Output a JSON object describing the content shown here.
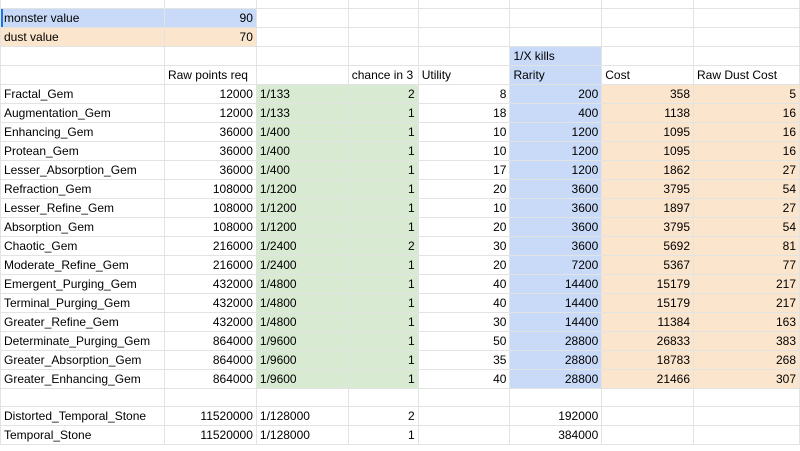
{
  "settings": [
    {
      "label": "monster value",
      "value": "90"
    },
    {
      "label": "dust value",
      "value": "70"
    }
  ],
  "header_top": {
    "rarity": "1/X kills"
  },
  "headers": {
    "raw_points": "Raw points req",
    "chance": "chance in 3",
    "utility": "Utility",
    "rarity": "Rarity",
    "cost": "Cost",
    "raw_dust": "Raw Dust Cost"
  },
  "rows": [
    {
      "name": "Fractal_Gem",
      "points": "12000",
      "frac": "1/133",
      "chance": "2",
      "utility": "8",
      "rarity": "200",
      "cost": "358",
      "dust": "5"
    },
    {
      "name": "Augmentation_Gem",
      "points": "12000",
      "frac": "1/133",
      "chance": "1",
      "utility": "18",
      "rarity": "400",
      "cost": "1138",
      "dust": "16"
    },
    {
      "name": "Enhancing_Gem",
      "points": "36000",
      "frac": "1/400",
      "chance": "1",
      "utility": "10",
      "rarity": "1200",
      "cost": "1095",
      "dust": "16"
    },
    {
      "name": "Protean_Gem",
      "points": "36000",
      "frac": "1/400",
      "chance": "1",
      "utility": "10",
      "rarity": "1200",
      "cost": "1095",
      "dust": "16"
    },
    {
      "name": "Lesser_Absorption_Gem",
      "points": "36000",
      "frac": "1/400",
      "chance": "1",
      "utility": "17",
      "rarity": "1200",
      "cost": "1862",
      "dust": "27"
    },
    {
      "name": "Refraction_Gem",
      "points": "108000",
      "frac": "1/1200",
      "chance": "1",
      "utility": "20",
      "rarity": "3600",
      "cost": "3795",
      "dust": "54"
    },
    {
      "name": "Lesser_Refine_Gem",
      "points": "108000",
      "frac": "1/1200",
      "chance": "1",
      "utility": "10",
      "rarity": "3600",
      "cost": "1897",
      "dust": "27"
    },
    {
      "name": "Absorption_Gem",
      "points": "108000",
      "frac": "1/1200",
      "chance": "1",
      "utility": "20",
      "rarity": "3600",
      "cost": "3795",
      "dust": "54"
    },
    {
      "name": "Chaotic_Gem",
      "points": "216000",
      "frac": "1/2400",
      "chance": "2",
      "utility": "30",
      "rarity": "3600",
      "cost": "5692",
      "dust": "81"
    },
    {
      "name": "Moderate_Refine_Gem",
      "points": "216000",
      "frac": "1/2400",
      "chance": "1",
      "utility": "20",
      "rarity": "7200",
      "cost": "5367",
      "dust": "77"
    },
    {
      "name": "Emergent_Purging_Gem",
      "points": "432000",
      "frac": "1/4800",
      "chance": "1",
      "utility": "40",
      "rarity": "14400",
      "cost": "15179",
      "dust": "217"
    },
    {
      "name": "Terminal_Purging_Gem",
      "points": "432000",
      "frac": "1/4800",
      "chance": "1",
      "utility": "40",
      "rarity": "14400",
      "cost": "15179",
      "dust": "217"
    },
    {
      "name": "Greater_Refine_Gem",
      "points": "432000",
      "frac": "1/4800",
      "chance": "1",
      "utility": "30",
      "rarity": "14400",
      "cost": "11384",
      "dust": "163"
    },
    {
      "name": "Determinate_Purging_Gem",
      "points": "864000",
      "frac": "1/9600",
      "chance": "1",
      "utility": "50",
      "rarity": "28800",
      "cost": "26833",
      "dust": "383"
    },
    {
      "name": "Greater_Absorption_Gem",
      "points": "864000",
      "frac": "1/9600",
      "chance": "1",
      "utility": "35",
      "rarity": "28800",
      "cost": "18783",
      "dust": "268"
    },
    {
      "name": "Greater_Enhancing_Gem",
      "points": "864000",
      "frac": "1/9600",
      "chance": "1",
      "utility": "40",
      "rarity": "28800",
      "cost": "21466",
      "dust": "307"
    }
  ],
  "stones": [
    {
      "name": "Distorted_Temporal_Stone",
      "points": "11520000",
      "frac": "1/128000",
      "chance": "2",
      "rarity": "192000"
    },
    {
      "name": "Temporal_Stone",
      "points": "11520000",
      "frac": "1/128000",
      "chance": "1",
      "rarity": "384000"
    }
  ]
}
